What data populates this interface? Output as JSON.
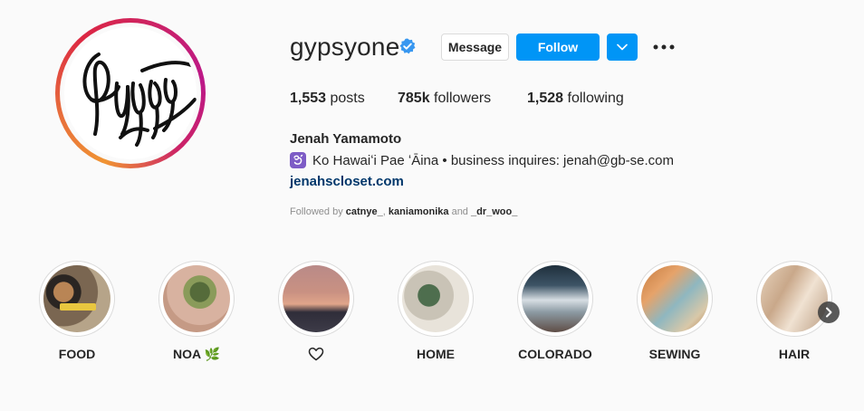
{
  "profile": {
    "username": "gypsyone",
    "verified_icon": "verified-badge-icon",
    "message_label": "Message",
    "follow_label": "Follow",
    "more_icon": "more-horizontal-icon",
    "dropdown_icon": "chevron-down-icon",
    "accent_color": "#0095f6"
  },
  "stats": {
    "posts_count": "1,553",
    "posts_label": " posts",
    "followers_count": "785k",
    "followers_label": " followers",
    "following_count": "1,528",
    "following_label": " following"
  },
  "bio": {
    "full_name": "Jenah Yamamoto",
    "emoji_icon": "hindu-symbol-icon",
    "line": "Ko Hawaiʻi Pae ʻĀina • business inquires: jenah@gb-se.com",
    "website": "jenahscloset.com",
    "followed_by_prefix": "Followed by ",
    "followed_by_1": "catnye_",
    "sep": ", ",
    "followed_by_2": "kaniamonika",
    "and": " and ",
    "followed_by_3": "_dr_woo_"
  },
  "highlights": [
    {
      "label": "FOOD"
    },
    {
      "label": "NOA 🌿"
    },
    {
      "label": "",
      "icon": "heart-outline-icon"
    },
    {
      "label": "HOME"
    },
    {
      "label": "COLORADO"
    },
    {
      "label": "SEWING"
    },
    {
      "label": "HAIR"
    }
  ],
  "carousel": {
    "next_icon": "chevron-right-icon"
  }
}
